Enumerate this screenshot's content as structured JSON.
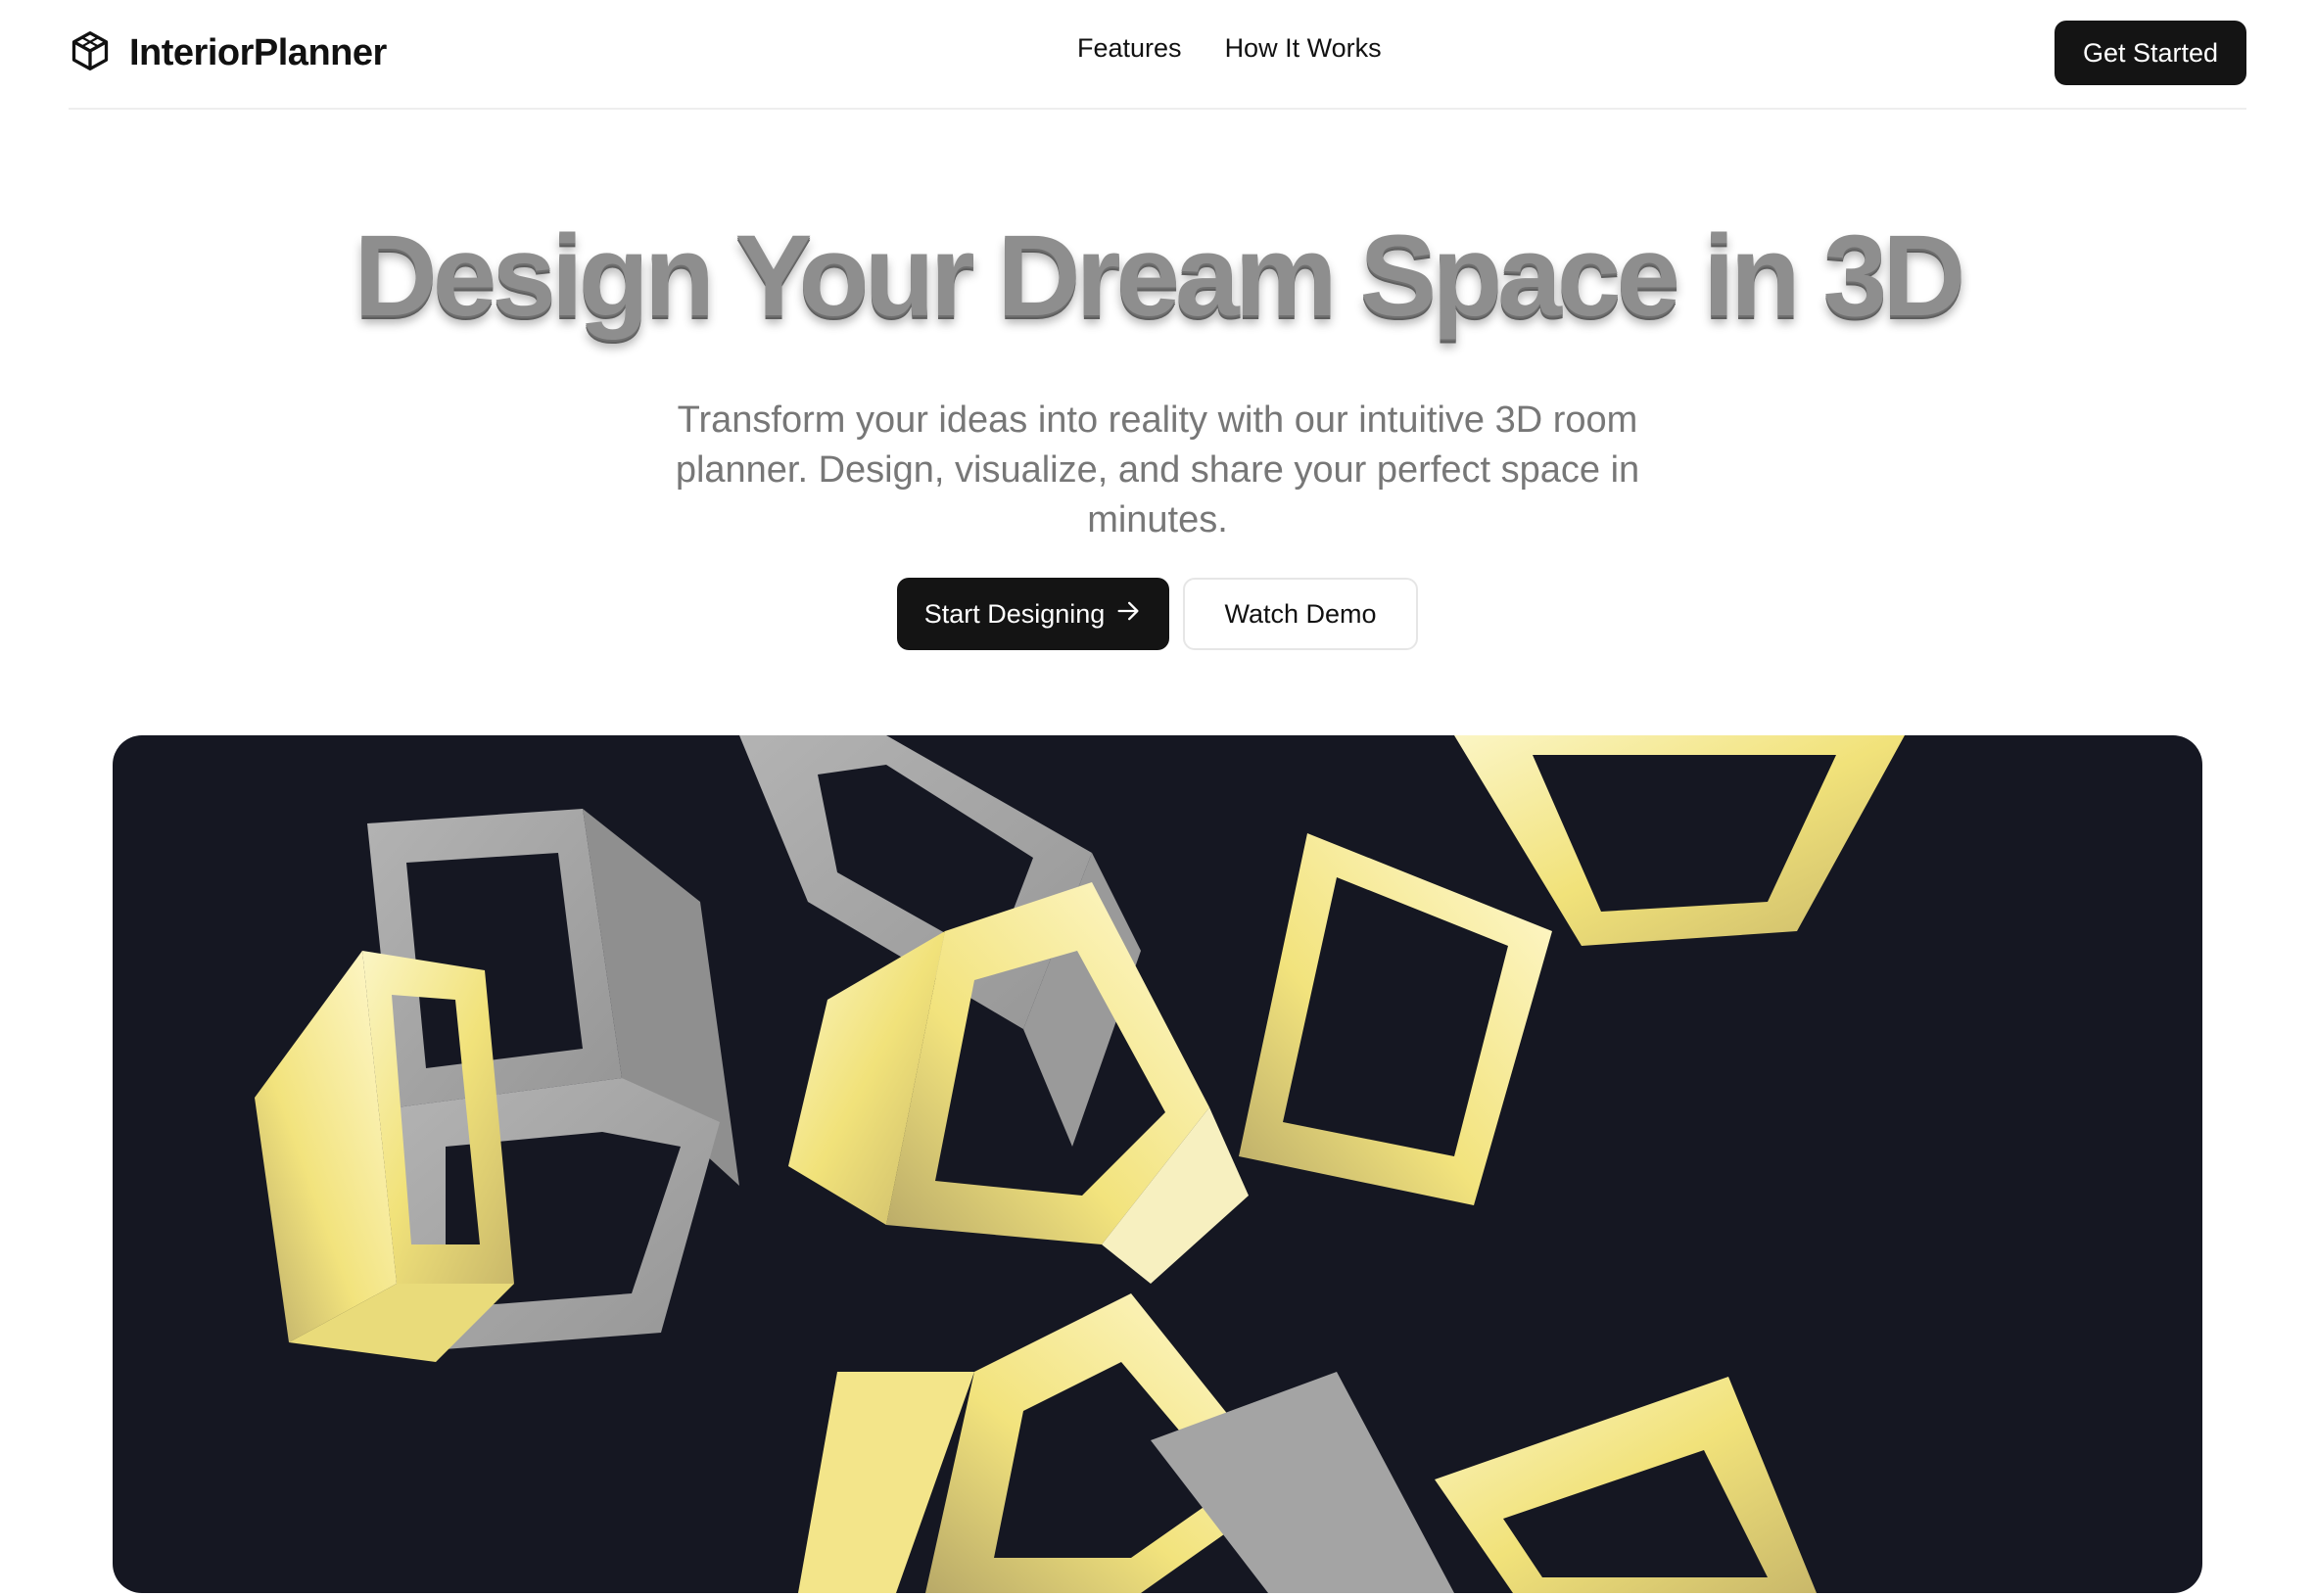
{
  "brand": {
    "name": "InteriorPlanner",
    "icon": "cube-icon"
  },
  "nav": {
    "links": [
      "Features",
      "How It Works"
    ],
    "cta_label": "Get Started"
  },
  "hero": {
    "title": "Design Your Dream Space in 3D",
    "subtitle": "Transform your ideas into reality with our intuitive 3D room planner. Design, visualize, and share your perfect space in minutes.",
    "primary_cta": "Start Designing",
    "primary_cta_icon": "arrow-right-icon",
    "secondary_cta": "Watch Demo"
  },
  "scene": {
    "background": "#151722",
    "frame_colors": {
      "gray": "#a3a3a3",
      "gold": "#f1e27a",
      "gold_light": "#fbf5c4"
    }
  }
}
